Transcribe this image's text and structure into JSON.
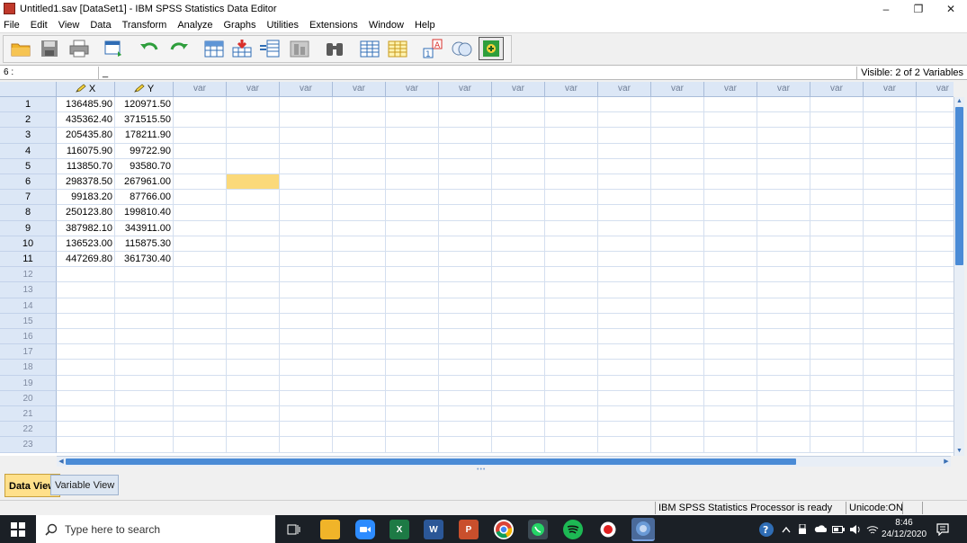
{
  "window": {
    "title": "Untitled1.sav [DataSet1] - IBM SPSS Statistics Data Editor",
    "minimize": "–",
    "restore": "❐",
    "close": "✕"
  },
  "menu": [
    "File",
    "Edit",
    "View",
    "Data",
    "Transform",
    "Analyze",
    "Graphs",
    "Utilities",
    "Extensions",
    "Window",
    "Help"
  ],
  "toolbar": {
    "icons": [
      "open-folder-icon",
      "save-icon",
      "print-icon",
      "dialog-recall-icon",
      "undo-icon",
      "redo-icon",
      "go-to-case-icon",
      "go-to-variable-icon",
      "variables-icon",
      "run-descriptives-icon",
      "find-icon",
      "insert-cases-icon",
      "insert-variable-icon",
      "split-file-icon",
      "value-labels-icon",
      "use-variable-sets-icon"
    ]
  },
  "editor": {
    "cell_reference": "6 :",
    "cell_value": "_",
    "visible_vars": "Visible: 2 of 2 Variables"
  },
  "grid": {
    "columns": [
      "X",
      "Y",
      "var",
      "var",
      "var",
      "var",
      "var",
      "var",
      "var",
      "var",
      "var",
      "var",
      "var",
      "var",
      "var",
      "var",
      "var"
    ],
    "rows": [
      {
        "n": "1",
        "x": "136485.90",
        "y": "120971.50"
      },
      {
        "n": "2",
        "x": "435362.40",
        "y": "371515.50"
      },
      {
        "n": "3",
        "x": "205435.80",
        "y": "178211.90"
      },
      {
        "n": "4",
        "x": "116075.90",
        "y": "99722.90"
      },
      {
        "n": "5",
        "x": "113850.70",
        "y": "93580.70"
      },
      {
        "n": "6",
        "x": "298378.50",
        "y": "267961.00"
      },
      {
        "n": "7",
        "x": "99183.20",
        "y": "87766.00"
      },
      {
        "n": "8",
        "x": "250123.80",
        "y": "199810.40"
      },
      {
        "n": "9",
        "x": "387982.10",
        "y": "343911.00"
      },
      {
        "n": "10",
        "x": "136523.00",
        "y": "115875.30"
      },
      {
        "n": "11",
        "x": "447269.80",
        "y": "361730.40"
      }
    ],
    "empty_rows": [
      "12",
      "13",
      "14",
      "15",
      "16",
      "17",
      "18",
      "19",
      "20",
      "21",
      "22",
      "23"
    ],
    "selected_row": 6,
    "selected_col": 4
  },
  "tabs": {
    "data_view": "Data View",
    "variable_view": "Variable View"
  },
  "status": {
    "processor": "IBM SPSS Statistics Processor is ready",
    "unicode": "Unicode:ON"
  },
  "taskbar": {
    "search_placeholder": "Type here to search",
    "time": "8:46",
    "date": "24/12/2020"
  },
  "colors": {
    "header_bg": "#dce7f6",
    "selected_cell": "#fbd97a",
    "scroll_thumb": "#4a8bd6"
  }
}
